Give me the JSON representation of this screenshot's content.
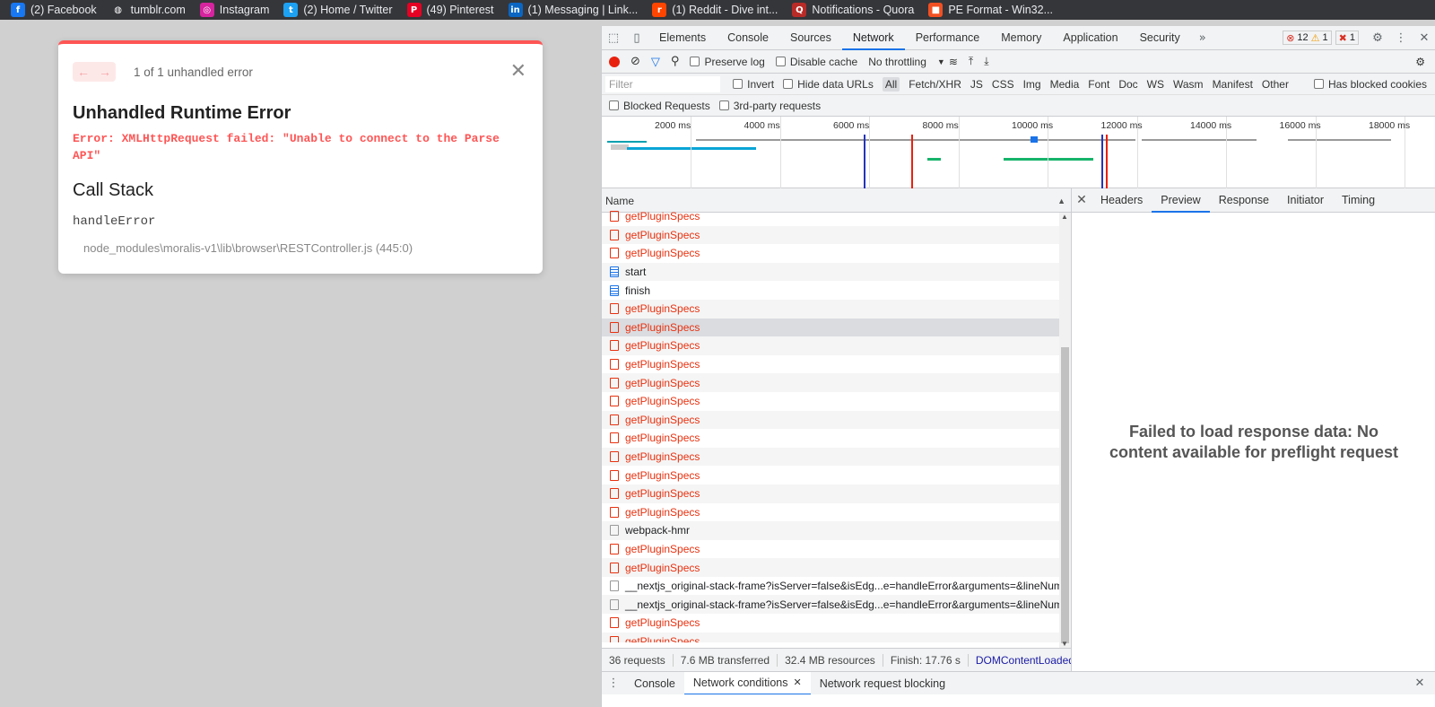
{
  "bookmarks": [
    {
      "label": "(2) Facebook",
      "icon": "facebook-icon",
      "glyph": "f",
      "color": "#1877f2"
    },
    {
      "label": "tumblr.com",
      "icon": "globe-icon",
      "glyph": "◍",
      "color": "#35363a"
    },
    {
      "label": "Instagram",
      "icon": "instagram-icon",
      "glyph": "◎",
      "color": "#d6249f"
    },
    {
      "label": "(2) Home / Twitter",
      "icon": "twitter-icon",
      "glyph": "t",
      "color": "#1da1f2"
    },
    {
      "label": "(49) Pinterest",
      "icon": "pinterest-icon",
      "glyph": "P",
      "color": "#e60023"
    },
    {
      "label": "(1) Messaging | Link...",
      "icon": "linkedin-icon",
      "glyph": "in",
      "color": "#0a66c2"
    },
    {
      "label": "(1) Reddit - Dive int...",
      "icon": "reddit-icon",
      "glyph": "r",
      "color": "#ff4500"
    },
    {
      "label": "Notifications - Quora",
      "icon": "quora-icon",
      "glyph": "Q",
      "color": "#b92b27"
    },
    {
      "label": "PE Format - Win32...",
      "icon": "microsoft-icon",
      "glyph": "■",
      "color": "#f25022"
    }
  ],
  "error_dialog": {
    "count_text": "1 of 1 unhandled error",
    "title": "Unhandled Runtime Error",
    "message": "Error: XMLHttpRequest failed: \"Unable to connect to the Parse API\"",
    "call_stack_title": "Call Stack",
    "function": "handleError",
    "file": "node_modules\\moralis-v1\\lib\\browser\\RESTController.js (445:0)"
  },
  "devtools": {
    "tabs": [
      "Elements",
      "Console",
      "Sources",
      "Network",
      "Performance",
      "Memory",
      "Application",
      "Security"
    ],
    "active_tab": "Network",
    "errors": "12",
    "warnings": "1",
    "issues": "1",
    "toolbar": {
      "preserve_log": "Preserve log",
      "disable_cache": "Disable cache",
      "throttling": "No throttling"
    },
    "filter": {
      "placeholder": "Filter",
      "invert": "Invert",
      "hide_data_urls": "Hide data URLs",
      "types": [
        "All",
        "Fetch/XHR",
        "JS",
        "CSS",
        "Img",
        "Media",
        "Font",
        "Doc",
        "WS",
        "Wasm",
        "Manifest",
        "Other"
      ],
      "has_blocked_cookies": "Has blocked cookies",
      "blocked_requests": "Blocked Requests",
      "third_party": "3rd-party requests"
    },
    "timeline_ticks": [
      "2000 ms",
      "4000 ms",
      "6000 ms",
      "8000 ms",
      "10000 ms",
      "12000 ms",
      "14000 ms",
      "16000 ms",
      "18000 ms"
    ],
    "name_header": "Name",
    "requests": [
      {
        "name": "getPluginSpecs",
        "type": "err"
      },
      {
        "name": "getPluginSpecs",
        "type": "err"
      },
      {
        "name": "getPluginSpecs",
        "type": "err"
      },
      {
        "name": "start",
        "type": "doc"
      },
      {
        "name": "finish",
        "type": "doc"
      },
      {
        "name": "getPluginSpecs",
        "type": "err"
      },
      {
        "name": "getPluginSpecs",
        "type": "err selected"
      },
      {
        "name": "getPluginSpecs",
        "type": "err"
      },
      {
        "name": "getPluginSpecs",
        "type": "err"
      },
      {
        "name": "getPluginSpecs",
        "type": "err"
      },
      {
        "name": "getPluginSpecs",
        "type": "err"
      },
      {
        "name": "getPluginSpecs",
        "type": "err"
      },
      {
        "name": "getPluginSpecs",
        "type": "err"
      },
      {
        "name": "getPluginSpecs",
        "type": "err"
      },
      {
        "name": "getPluginSpecs",
        "type": "err"
      },
      {
        "name": "getPluginSpecs",
        "type": "err"
      },
      {
        "name": "getPluginSpecs",
        "type": "err"
      },
      {
        "name": "webpack-hmr",
        "type": "plain"
      },
      {
        "name": "getPluginSpecs",
        "type": "err"
      },
      {
        "name": "getPluginSpecs",
        "type": "err"
      },
      {
        "name": "__nextjs_original-stack-frame?isServer=false&isEdg...e=handleError&arguments=&lineNumb",
        "type": "plain"
      },
      {
        "name": "__nextjs_original-stack-frame?isServer=false&isEdg...e=handleError&arguments=&lineNumb",
        "type": "plain"
      },
      {
        "name": "getPluginSpecs",
        "type": "err"
      },
      {
        "name": "getPluginSpecs",
        "type": "err"
      }
    ],
    "status": {
      "requests": "36 requests",
      "transferred": "7.6 MB transferred",
      "resources": "32.4 MB resources",
      "finish": "Finish: 17.76 s",
      "dcl": "DOMContentLoaded:"
    },
    "detail_tabs": [
      "Headers",
      "Preview",
      "Response",
      "Initiator",
      "Timing"
    ],
    "active_detail_tab": "Preview",
    "detail_message": "Failed to load response data: No content available for preflight request",
    "drawer_tabs": [
      "Console",
      "Network conditions",
      "Network request blocking"
    ],
    "active_drawer_tab": "Network conditions"
  }
}
